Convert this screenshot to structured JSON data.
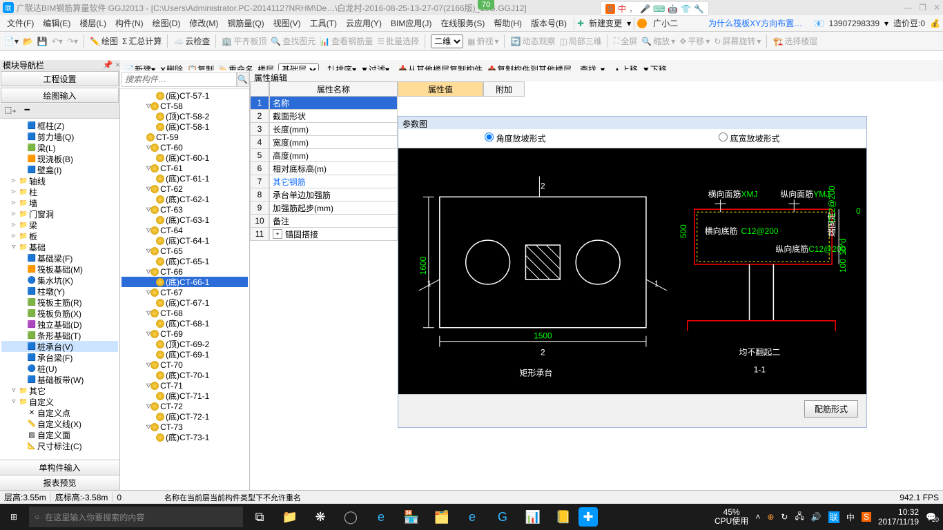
{
  "titlebar": {
    "appicon": "联",
    "title": "广联达BIM钢筋算量软件 GGJ2013 - [C:\\Users\\Administrator.PC-20141127NRHM\\De…\\白龙村-2016-08-25-13-27-07(2166版)_16G.GGJ12]",
    "badge": "70",
    "ime": {
      "logo": "S",
      "items": [
        "中",
        "，",
        "🎤",
        "⌨",
        "🤖",
        "👕",
        "🔧"
      ]
    },
    "winbtns": [
      "—",
      "❐",
      "✕",
      "—",
      "❐",
      "✕"
    ]
  },
  "menubar": {
    "items": [
      "文件(F)",
      "编辑(E)",
      "楼层(L)",
      "构件(N)",
      "绘图(D)",
      "修改(M)",
      "钢筋量(Q)",
      "视图(V)",
      "工具(T)",
      "云应用(Y)",
      "BIM应用(J)",
      "在线服务(S)",
      "帮助(H)",
      "版本号(B)"
    ],
    "newchange": "新建变更",
    "user": "广小二",
    "bluelink": "为什么筏板XY方向布置…",
    "phone": "13907298339",
    "beans": "造价豆:0"
  },
  "toolbar": {
    "items1": [
      "📄",
      "📂",
      "💾",
      "←",
      "→"
    ],
    "drawing": "绘图",
    "sum": "汇总计算",
    "cloud": "云检查",
    "flat": "平齐板顶",
    "findview": "查找图元",
    "viewrebar": "查看钢筋量",
    "batchsel": "批量选择",
    "viewmode": "二维",
    "lookdown": "俯视",
    "dynview": "动态观察",
    "local3d": "局部三维",
    "fullscreen": "全屏",
    "zoom": "缩放",
    "pan": "平移",
    "rotate": "屏幕旋转",
    "selfloor": "选择楼层"
  },
  "toolbar2": {
    "new": "新建",
    "del": "删除",
    "copy": "复制",
    "rename": "重命名",
    "floor": "楼层",
    "foundation": "基础层",
    "sort": "排序",
    "filter": "过滤",
    "copyfrom": "从其他楼层复制构件",
    "copyto": "复制构件到其他楼层",
    "find": "查找",
    "up": "上移",
    "down": "下移"
  },
  "navpanel": {
    "title": "模块导航栏",
    "proj": "工程设置",
    "drawin": "绘图输入",
    "tabs": [
      "⬚₊",
      "━"
    ],
    "tree": [
      {
        "lv": 2,
        "ico": "🟦",
        "label": "框柱(Z)"
      },
      {
        "lv": 2,
        "ico": "🟦",
        "label": "剪力墙(Q)"
      },
      {
        "lv": 2,
        "ico": "🟩",
        "label": "梁(L)"
      },
      {
        "lv": 2,
        "ico": "🟧",
        "label": "现浇板(B)"
      },
      {
        "lv": 2,
        "ico": "🟦",
        "label": "壁龛(I)"
      },
      {
        "lv": 1,
        "exp": "▷",
        "label": "轴线"
      },
      {
        "lv": 1,
        "exp": "▷",
        "label": "柱"
      },
      {
        "lv": 1,
        "exp": "▷",
        "label": "墙"
      },
      {
        "lv": 1,
        "exp": "▷",
        "label": "门窗洞"
      },
      {
        "lv": 1,
        "exp": "▷",
        "label": "梁"
      },
      {
        "lv": 1,
        "exp": "▷",
        "label": "板"
      },
      {
        "lv": 1,
        "exp": "▽",
        "label": "基础"
      },
      {
        "lv": 2,
        "ico": "🟦",
        "label": "基础梁(F)"
      },
      {
        "lv": 2,
        "ico": "🟧",
        "label": "筏板基础(M)"
      },
      {
        "lv": 2,
        "ico": "🔵",
        "label": "集水坑(K)"
      },
      {
        "lv": 2,
        "ico": "🟦",
        "label": "柱墩(Y)"
      },
      {
        "lv": 2,
        "ico": "🟩",
        "label": "筏板主筋(R)"
      },
      {
        "lv": 2,
        "ico": "🟩",
        "label": "筏板负筋(X)"
      },
      {
        "lv": 2,
        "ico": "🟪",
        "label": "独立基础(D)"
      },
      {
        "lv": 2,
        "ico": "🟩",
        "label": "条形基础(T)"
      },
      {
        "lv": 2,
        "ico": "🟦",
        "label": "桩承台(V)",
        "sel": true
      },
      {
        "lv": 2,
        "ico": "🟦",
        "label": "承台梁(F)"
      },
      {
        "lv": 2,
        "ico": "🔵",
        "label": "桩(U)"
      },
      {
        "lv": 2,
        "ico": "🟦",
        "label": "基础板带(W)"
      },
      {
        "lv": 1,
        "exp": "▽",
        "label": "其它"
      },
      {
        "lv": 1,
        "exp": "▽",
        "label": "自定义"
      },
      {
        "lv": 2,
        "ico": "✕",
        "label": "自定义点"
      },
      {
        "lv": 2,
        "ico": "📏",
        "label": "自定义线(X)"
      },
      {
        "lv": 2,
        "ico": "▨",
        "label": "自定义面"
      },
      {
        "lv": 2,
        "ico": "📐",
        "label": "尺寸标注(C)"
      }
    ],
    "bottom1": "单构件输入",
    "bottom2": "报表预览"
  },
  "midpanel": {
    "search_ph": "搜索构件…",
    "tree": [
      {
        "lv": 3,
        "gear": true,
        "label": "(底)CT-57-1"
      },
      {
        "lv": 2,
        "exp": "▽",
        "gear": true,
        "label": "CT-58"
      },
      {
        "lv": 3,
        "gear": true,
        "label": "(顶)CT-58-2"
      },
      {
        "lv": 3,
        "gear": true,
        "label": "(底)CT-58-1"
      },
      {
        "lv": 2,
        "gear": true,
        "label": "CT-59"
      },
      {
        "lv": 2,
        "exp": "▽",
        "gear": true,
        "label": "CT-60"
      },
      {
        "lv": 3,
        "gear": true,
        "label": "(底)CT-60-1"
      },
      {
        "lv": 2,
        "exp": "▽",
        "gear": true,
        "label": "CT-61"
      },
      {
        "lv": 3,
        "gear": true,
        "label": "(底)CT-61-1"
      },
      {
        "lv": 2,
        "exp": "▽",
        "gear": true,
        "label": "CT-62"
      },
      {
        "lv": 3,
        "gear": true,
        "label": "(底)CT-62-1"
      },
      {
        "lv": 2,
        "exp": "▽",
        "gear": true,
        "label": "CT-63"
      },
      {
        "lv": 3,
        "gear": true,
        "label": "(底)CT-63-1"
      },
      {
        "lv": 2,
        "exp": "▽",
        "gear": true,
        "label": "CT-64"
      },
      {
        "lv": 3,
        "gear": true,
        "label": "(底)CT-64-1"
      },
      {
        "lv": 2,
        "exp": "▽",
        "gear": true,
        "label": "CT-65"
      },
      {
        "lv": 3,
        "gear": true,
        "label": "(底)CT-65-1"
      },
      {
        "lv": 2,
        "exp": "▽",
        "gear": true,
        "label": "CT-66"
      },
      {
        "lv": 3,
        "gear": true,
        "label": "(底)CT-66-1",
        "sel": true
      },
      {
        "lv": 2,
        "exp": "▽",
        "gear": true,
        "label": "CT-67"
      },
      {
        "lv": 3,
        "gear": true,
        "label": "(底)CT-67-1"
      },
      {
        "lv": 2,
        "exp": "▽",
        "gear": true,
        "label": "CT-68"
      },
      {
        "lv": 3,
        "gear": true,
        "label": "(底)CT-68-1"
      },
      {
        "lv": 2,
        "exp": "▽",
        "gear": true,
        "label": "CT-69"
      },
      {
        "lv": 3,
        "gear": true,
        "label": "(顶)CT-69-2"
      },
      {
        "lv": 3,
        "gear": true,
        "label": "(底)CT-69-1"
      },
      {
        "lv": 2,
        "exp": "▽",
        "gear": true,
        "label": "CT-70"
      },
      {
        "lv": 3,
        "gear": true,
        "label": "(底)CT-70-1"
      },
      {
        "lv": 2,
        "exp": "▽",
        "gear": true,
        "label": "CT-71"
      },
      {
        "lv": 3,
        "gear": true,
        "label": "(底)CT-71-1"
      },
      {
        "lv": 2,
        "exp": "▽",
        "gear": true,
        "label": "CT-72"
      },
      {
        "lv": 3,
        "gear": true,
        "label": "(底)CT-72-1"
      },
      {
        "lv": 2,
        "exp": "▽",
        "gear": true,
        "label": "CT-73"
      },
      {
        "lv": 3,
        "gear": true,
        "label": "(底)CT-73-1"
      }
    ]
  },
  "props": {
    "header": "属性编辑",
    "cols": {
      "name": "属性名称",
      "val": "属性值",
      "add": "附加"
    },
    "rows": [
      {
        "i": "1",
        "n": "名称",
        "sel": true
      },
      {
        "i": "2",
        "n": "截面形状"
      },
      {
        "i": "3",
        "n": "长度(mm)"
      },
      {
        "i": "4",
        "n": "宽度(mm)"
      },
      {
        "i": "5",
        "n": "高度(mm)"
      },
      {
        "i": "6",
        "n": "相对底标高(m)"
      },
      {
        "i": "7",
        "n": "其它钢筋",
        "blue": true
      },
      {
        "i": "8",
        "n": "承台单边加强筋"
      },
      {
        "i": "9",
        "n": "加强筋起步(mm)"
      },
      {
        "i": "10",
        "n": "备注"
      },
      {
        "i": "11",
        "n": "锚固搭接",
        "exp": true
      }
    ]
  },
  "param": {
    "title": "参数图",
    "opt1": "角度放坡形式",
    "opt2": "底宽放坡形式",
    "btn": "配筋形式",
    "diagram": {
      "left_title": "矩形承台",
      "right_title": "均不翻起二",
      "right_sub": "1-1",
      "dims": {
        "len": "1500",
        "h": "1600",
        "top_num": "2",
        "bot_num": "2",
        "l1": "1",
        "r1": "1"
      },
      "right_labels": {
        "hx_top": "横向面筋",
        "hx_top_v": "XMJ",
        "zx_top": "纵向面筋",
        "zx_top_v": "YMJ",
        "hx_bot": "横向底筋",
        "hx_bot_v": "C12@200",
        "zx_bot": "纵向底筋",
        "zx_bot_v": "C12@200",
        "h500": "500",
        "d100": "100",
        "d0": "0",
        "d10d": "10*d",
        "side": "端固定",
        "side_v": "C12@200"
      }
    }
  },
  "status": {
    "floor_h": "层高:3.55m",
    "bottom_h": "底标高:-3.58m",
    "zero": "0",
    "msg": "名称在当前层当前构件类型下不允许重名",
    "fps": "942.1 FPS"
  },
  "taskbar": {
    "search_ph": "在这里输入你要搜索的内容",
    "cpu_pct": "45%",
    "cpu_lbl": "CPU使用",
    "time": "10:32",
    "date": "2017/11/19",
    "notif": "20"
  }
}
